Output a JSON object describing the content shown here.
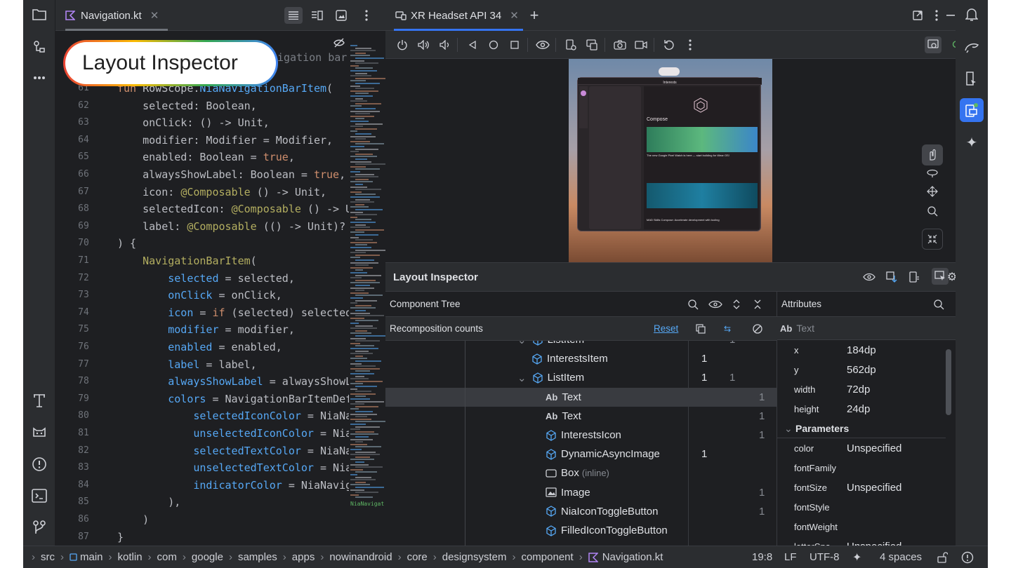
{
  "editor": {
    "tab_label": "Navigation.kt",
    "line_numbers": [
      "61",
      "62",
      "63",
      "64",
      "65",
      "66",
      "67",
      "68",
      "69",
      "70",
      "71",
      "72",
      "73",
      "74",
      "75",
      "76",
      "77",
      "78",
      "79",
      "80",
      "81",
      "82",
      "83",
      "84",
      "85",
      "86",
      "87"
    ],
    "hidden_comment": "igation bar item",
    "code": [
      [
        [
          "kw",
          "fun "
        ],
        [
          "",
          "RowScope."
        ],
        [
          "fn",
          "NiaNavigationBarItem"
        ],
        [
          "",
          "("
        ]
      ],
      [
        [
          "",
          "    selected: Boolean,"
        ]
      ],
      [
        [
          "",
          "    onClick: () -> Unit,"
        ]
      ],
      [
        [
          "",
          "    modifier: Modifier = Modifier,"
        ]
      ],
      [
        [
          "",
          "    enabled: Boolean = "
        ],
        [
          "kw",
          "true"
        ],
        [
          "",
          ","
        ]
      ],
      [
        [
          "",
          "    alwaysShowLabel: Boolean = "
        ],
        [
          "kw",
          "true"
        ],
        [
          "",
          ","
        ]
      ],
      [
        [
          "",
          "    icon: "
        ],
        [
          "an",
          "@Composable"
        ],
        [
          "",
          " () -> Unit,"
        ]
      ],
      [
        [
          "",
          "    selectedIcon: "
        ],
        [
          "an",
          "@Composable"
        ],
        [
          "",
          " () -> Un"
        ]
      ],
      [
        [
          "",
          "    label: "
        ],
        [
          "an",
          "@Composable"
        ],
        [
          "",
          " (() -> Unit)? ="
        ]
      ],
      [
        [
          "",
          ") {"
        ]
      ],
      [
        [
          "",
          "    "
        ],
        [
          "an",
          "NavigationBarItem"
        ],
        [
          "",
          "("
        ]
      ],
      [
        [
          "",
          "        "
        ],
        [
          "pm",
          "selected"
        ],
        [
          "",
          " = selected,"
        ]
      ],
      [
        [
          "",
          "        "
        ],
        [
          "pm",
          "onClick"
        ],
        [
          "",
          " = onClick,"
        ]
      ],
      [
        [
          "",
          "        "
        ],
        [
          "pm",
          "icon"
        ],
        [
          "",
          " = "
        ],
        [
          "kw",
          "if"
        ],
        [
          "",
          " (selected) selectedI"
        ]
      ],
      [
        [
          "",
          "        "
        ],
        [
          "pm",
          "modifier"
        ],
        [
          "",
          " = modifier,"
        ]
      ],
      [
        [
          "",
          "        "
        ],
        [
          "pm",
          "enabled"
        ],
        [
          "",
          " = enabled,"
        ]
      ],
      [
        [
          "",
          "        "
        ],
        [
          "pm",
          "label"
        ],
        [
          "",
          " = label,"
        ]
      ],
      [
        [
          "",
          "        "
        ],
        [
          "pm",
          "alwaysShowLabel"
        ],
        [
          "",
          " = alwaysShowLa"
        ]
      ],
      [
        [
          "",
          "        "
        ],
        [
          "pm",
          "colors"
        ],
        [
          "",
          " = NavigationBarItemDefa"
        ]
      ],
      [
        [
          "",
          "            "
        ],
        [
          "pm",
          "selectedIconColor"
        ],
        [
          "",
          " = NiaNav"
        ]
      ],
      [
        [
          "",
          "            "
        ],
        [
          "pm",
          "unselectedIconColor"
        ],
        [
          "",
          " = NiaN"
        ]
      ],
      [
        [
          "",
          "            "
        ],
        [
          "pm",
          "selectedTextColor"
        ],
        [
          "",
          " = NiaNav"
        ]
      ],
      [
        [
          "",
          "            "
        ],
        [
          "pm",
          "unselectedTextColor"
        ],
        [
          "",
          " = NiaN"
        ]
      ],
      [
        [
          "",
          "            "
        ],
        [
          "pm",
          "indicatorColor"
        ],
        [
          "",
          " = NiaNaviga"
        ]
      ],
      [
        [
          "",
          "        ),"
        ]
      ],
      [
        [
          "",
          "    )"
        ]
      ],
      [
        [
          "",
          "}"
        ]
      ]
    ],
    "minimap_label": "NiaNavigat"
  },
  "overlay_badge": "Layout Inspector",
  "device": {
    "tab_label": "XR Headset API 34",
    "app_title": "Interests",
    "app_heading": "Compose",
    "card1": "The new Google Pixel Watch is here — start building for Wear OS!",
    "card2": "MAD Skills Compose: Accelerate development with tooling"
  },
  "inspector": {
    "title": "Layout Inspector",
    "component_tree_label": "Component Tree",
    "recomposition_label": "Recomposition counts",
    "reset_label": "Reset",
    "attributes_label": "Attributes",
    "selected_node": "Text",
    "rows": [
      {
        "label": "ListItem",
        "c1": "",
        "c2": "1",
        "c3": ""
      },
      {
        "label": "InterestsItem",
        "c1": "1",
        "c2": "",
        "c3": ""
      },
      {
        "label": "ListItem",
        "c1": "1",
        "c2": "1",
        "c3": ""
      },
      {
        "label": "Text",
        "c1": "",
        "c2": "",
        "c3": "1"
      },
      {
        "label": "Text",
        "c1": "",
        "c2": "",
        "c3": "1"
      },
      {
        "label": "InterestsIcon",
        "c1": "",
        "c2": "",
        "c3": "1"
      },
      {
        "label": "DynamicAsyncImage",
        "c1": "1",
        "c2": "",
        "c3": ""
      },
      {
        "label": "Box",
        "c1": "",
        "c2": "",
        "c3": ""
      },
      {
        "label": "Image",
        "c1": "",
        "c2": "",
        "c3": "1"
      },
      {
        "label": "NiaIconToggleButton",
        "c1": "",
        "c2": "",
        "c3": "1"
      },
      {
        "label": "FilledIconToggleButton",
        "c1": "",
        "c2": "",
        "c3": ""
      }
    ],
    "box_suffix": "(inline)",
    "attributes": [
      {
        "k": "x",
        "v": "184dp"
      },
      {
        "k": "y",
        "v": "562dp"
      },
      {
        "k": "width",
        "v": "72dp"
      },
      {
        "k": "height",
        "v": "24dp"
      }
    ],
    "parameters_label": "Parameters",
    "params": [
      {
        "k": "color",
        "v": "Unspecified"
      },
      {
        "k": "fontFamily",
        "v": ""
      },
      {
        "k": "fontSize",
        "v": "Unspecified"
      },
      {
        "k": "fontStyle",
        "v": ""
      },
      {
        "k": "fontWeight",
        "v": ""
      },
      {
        "k": "letterSpa",
        "v": "Unspecified"
      }
    ]
  },
  "status": {
    "crumbs": [
      "src",
      "main",
      "kotlin",
      "com",
      "google",
      "samples",
      "apps",
      "nowinandroid",
      "core",
      "designsystem",
      "component",
      "Navigation.kt"
    ],
    "position": "19:8",
    "line_sep": "LF",
    "encoding": "UTF-8",
    "indent": "4 spaces"
  }
}
